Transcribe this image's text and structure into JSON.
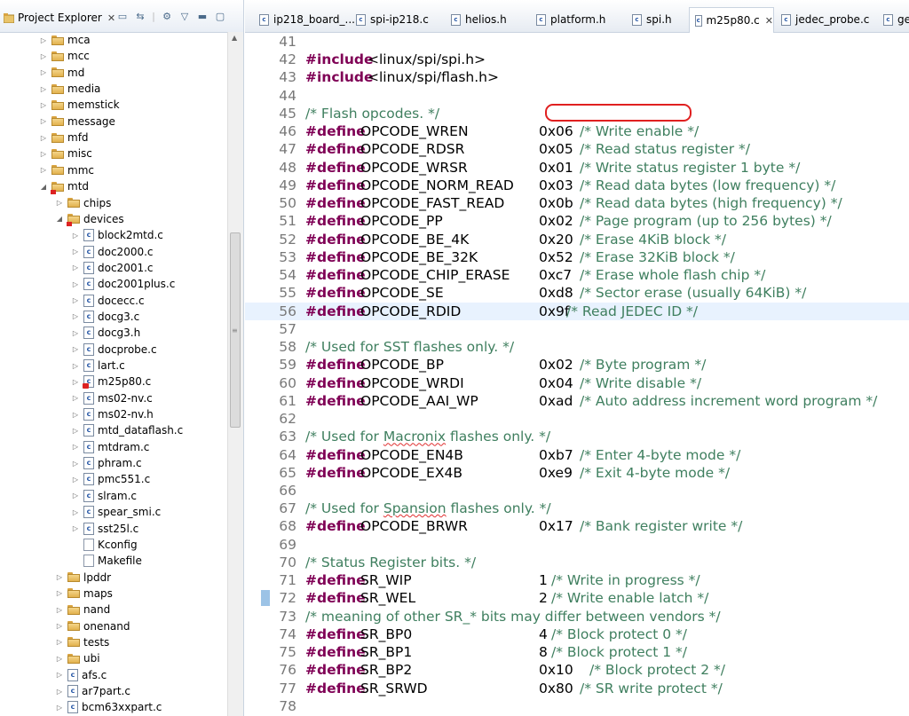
{
  "explorer": {
    "title": "Project Explorer",
    "tree": [
      {
        "label": "mca",
        "type": "folder",
        "indent": 0,
        "expanded": false
      },
      {
        "label": "mcc",
        "type": "folder",
        "indent": 0,
        "expanded": false
      },
      {
        "label": "md",
        "type": "folder",
        "indent": 0,
        "expanded": false
      },
      {
        "label": "media",
        "type": "folder",
        "indent": 0,
        "expanded": false
      },
      {
        "label": "memstick",
        "type": "folder",
        "indent": 0,
        "expanded": false
      },
      {
        "label": "message",
        "type": "folder",
        "indent": 0,
        "expanded": false
      },
      {
        "label": "mfd",
        "type": "folder",
        "indent": 0,
        "expanded": false
      },
      {
        "label": "misc",
        "type": "folder",
        "indent": 0,
        "expanded": false
      },
      {
        "label": "mmc",
        "type": "folder",
        "indent": 0,
        "expanded": false
      },
      {
        "label": "mtd",
        "type": "folder",
        "indent": 0,
        "expanded": true,
        "error": true
      },
      {
        "label": "chips",
        "type": "folder",
        "indent": 1,
        "expanded": false
      },
      {
        "label": "devices",
        "type": "folder",
        "indent": 1,
        "expanded": true,
        "error": true
      },
      {
        "label": "block2mtd.c",
        "type": "cfile",
        "indent": 2
      },
      {
        "label": "doc2000.c",
        "type": "cfile",
        "indent": 2
      },
      {
        "label": "doc2001.c",
        "type": "cfile",
        "indent": 2
      },
      {
        "label": "doc2001plus.c",
        "type": "cfile",
        "indent": 2
      },
      {
        "label": "docecc.c",
        "type": "cfile",
        "indent": 2
      },
      {
        "label": "docg3.c",
        "type": "cfile",
        "indent": 2
      },
      {
        "label": "docg3.h",
        "type": "cfile",
        "indent": 2
      },
      {
        "label": "docprobe.c",
        "type": "cfile",
        "indent": 2
      },
      {
        "label": "lart.c",
        "type": "cfile",
        "indent": 2
      },
      {
        "label": "m25p80.c",
        "type": "cfile",
        "indent": 2,
        "error": true
      },
      {
        "label": "ms02-nv.c",
        "type": "cfile",
        "indent": 2
      },
      {
        "label": "ms02-nv.h",
        "type": "cfile",
        "indent": 2
      },
      {
        "label": "mtd_dataflash.c",
        "type": "cfile",
        "indent": 2
      },
      {
        "label": "mtdram.c",
        "type": "cfile",
        "indent": 2
      },
      {
        "label": "phram.c",
        "type": "cfile",
        "indent": 2
      },
      {
        "label": "pmc551.c",
        "type": "cfile",
        "indent": 2
      },
      {
        "label": "slram.c",
        "type": "cfile",
        "indent": 2
      },
      {
        "label": "spear_smi.c",
        "type": "cfile",
        "indent": 2
      },
      {
        "label": "sst25l.c",
        "type": "cfile",
        "indent": 2
      },
      {
        "label": "Kconfig",
        "type": "plain",
        "indent": 2
      },
      {
        "label": "Makefile",
        "type": "plain",
        "indent": 2
      },
      {
        "label": "lpddr",
        "type": "folder",
        "indent": 1,
        "expanded": false
      },
      {
        "label": "maps",
        "type": "folder",
        "indent": 1,
        "expanded": false
      },
      {
        "label": "nand",
        "type": "folder",
        "indent": 1,
        "expanded": false
      },
      {
        "label": "onenand",
        "type": "folder",
        "indent": 1,
        "expanded": false
      },
      {
        "label": "tests",
        "type": "folder",
        "indent": 1,
        "expanded": false
      },
      {
        "label": "ubi",
        "type": "folder",
        "indent": 1,
        "expanded": false
      },
      {
        "label": "afs.c",
        "type": "cfile",
        "indent": 1
      },
      {
        "label": "ar7part.c",
        "type": "cfile",
        "indent": 1
      },
      {
        "label": "bcm63xxpart.c",
        "type": "cfile",
        "indent": 1
      }
    ]
  },
  "editor_tabs": [
    {
      "label": "ip218_board_...",
      "active": false
    },
    {
      "label": "spi-ip218.c",
      "active": false
    },
    {
      "label": "helios.h",
      "active": false
    },
    {
      "label": "platform.h",
      "active": false
    },
    {
      "label": "spi.h",
      "active": false
    },
    {
      "label": "m25p80.c",
      "active": true
    },
    {
      "label": "jedec_probe.c",
      "active": false
    },
    {
      "label": "ge",
      "active": false
    }
  ],
  "code_lines": [
    {
      "n": "41"
    },
    {
      "n": "42",
      "kw": "#include",
      "rest": "<linux/spi/spi.h>",
      "kind": "include"
    },
    {
      "n": "43",
      "kw": "#include",
      "rest": "<linux/spi/flash.h>",
      "kind": "include"
    },
    {
      "n": "44"
    },
    {
      "n": "45",
      "comment": "/* Flash opcodes. */"
    },
    {
      "n": "46",
      "kw": "#define",
      "name": "OPCODE_WREN",
      "val": "0x06",
      "cmt": "/* Write enable */"
    },
    {
      "n": "47",
      "kw": "#define",
      "name": "OPCODE_RDSR",
      "val": "0x05",
      "cmt": "/* Read status register */"
    },
    {
      "n": "48",
      "kw": "#define",
      "name": "OPCODE_WRSR",
      "val": "0x01",
      "cmt": "/* Write status register 1 byte */"
    },
    {
      "n": "49",
      "kw": "#define",
      "name": "OPCODE_NORM_READ",
      "val": "0x03",
      "cmt": "/* Read data bytes (low frequency) */"
    },
    {
      "n": "50",
      "kw": "#define",
      "name": "OPCODE_FAST_READ",
      "val": "0x0b",
      "cmt": "/* Read data bytes (high frequency) */"
    },
    {
      "n": "51",
      "kw": "#define",
      "name": "OPCODE_PP",
      "val": "0x02",
      "cmt": "/* Page program (up to 256 bytes) */"
    },
    {
      "n": "52",
      "kw": "#define",
      "name": "OPCODE_BE_4K",
      "val": "0x20",
      "cmt": "/* Erase 4KiB block */"
    },
    {
      "n": "53",
      "kw": "#define",
      "name": "OPCODE_BE_32K",
      "val": "0x52",
      "cmt": "/* Erase 32KiB block */"
    },
    {
      "n": "54",
      "kw": "#define",
      "name": "OPCODE_CHIP_ERASE",
      "val": "0xc7",
      "cmt": "/* Erase whole flash chip */"
    },
    {
      "n": "55",
      "kw": "#define",
      "name": "OPCODE_SE",
      "val": "0xd8",
      "cmt": "/* Sector erase (usually 64KiB) */"
    },
    {
      "n": "56",
      "kw": "#define",
      "name": "OPCODE_RDID",
      "val": "0x9f",
      "cmt": "/* Read JEDEC ID */",
      "highlight": true,
      "tight": true
    },
    {
      "n": "57"
    },
    {
      "n": "58",
      "comment": "/* Used for SST flashes only. */"
    },
    {
      "n": "59",
      "kw": "#define",
      "name": "OPCODE_BP",
      "val": "0x02",
      "cmt": "/* Byte program */"
    },
    {
      "n": "60",
      "kw": "#define",
      "name": "OPCODE_WRDI",
      "val": "0x04",
      "cmt": "/* Write disable */"
    },
    {
      "n": "61",
      "kw": "#define",
      "name": "OPCODE_AAI_WP",
      "val": "0xad",
      "cmt": "/* Auto address increment word program */"
    },
    {
      "n": "62"
    },
    {
      "n": "63",
      "comment": "/* Used for Macronix flashes only. */",
      "squig": "Macronix"
    },
    {
      "n": "64",
      "kw": "#define",
      "name": "OPCODE_EN4B",
      "val": "0xb7",
      "cmt": "/* Enter 4-byte mode */"
    },
    {
      "n": "65",
      "kw": "#define",
      "name": "OPCODE_EX4B",
      "val": "0xe9",
      "cmt": "/* Exit 4-byte mode */"
    },
    {
      "n": "66"
    },
    {
      "n": "67",
      "comment": "/* Used for Spansion flashes only. */",
      "squig": "Spansion"
    },
    {
      "n": "68",
      "kw": "#define",
      "name": "OPCODE_BRWR",
      "val": "0x17",
      "cmt": "/* Bank register write */"
    },
    {
      "n": "69"
    },
    {
      "n": "70",
      "comment": "/* Status Register bits. */"
    },
    {
      "n": "71",
      "kw": "#define",
      "name": "SR_WIP",
      "val": "1",
      "cmt": "/* Write in progress */",
      "short": true
    },
    {
      "n": "72",
      "kw": "#define",
      "name": "SR_WEL",
      "val": "2",
      "cmt": "/* Write enable latch */",
      "short": true
    },
    {
      "n": "73",
      "comment": "/* meaning of other SR_* bits may differ between vendors */"
    },
    {
      "n": "74",
      "kw": "#define",
      "name": "SR_BP0",
      "val": "4",
      "cmt": "/* Block protect 0 */",
      "short": true
    },
    {
      "n": "75",
      "kw": "#define",
      "name": "SR_BP1",
      "val": "8",
      "cmt": "/* Block protect 1 */",
      "short": true
    },
    {
      "n": "76",
      "kw": "#define",
      "name": "SR_BP2",
      "val": "0x10",
      "cmt": "/* Block protect 2 */",
      "short": true
    },
    {
      "n": "77",
      "kw": "#define",
      "name": "SR_SRWD",
      "val": "0x80",
      "cmt": "/* SR write protect */"
    },
    {
      "n": "78"
    }
  ],
  "colors": {
    "keyword": "#7f0055",
    "string": "#2a00ff",
    "comment": "#3f7f5f",
    "highlight": "#e8f2fe",
    "annotation": "#e02020"
  }
}
